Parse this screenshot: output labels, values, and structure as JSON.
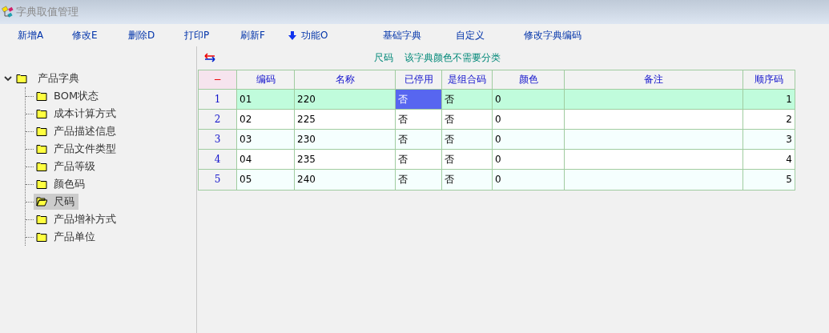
{
  "window": {
    "title": "字典取值管理"
  },
  "toolbar": [
    {
      "label": "新增A",
      "kind": "text"
    },
    {
      "label": "修改E",
      "kind": "text"
    },
    {
      "label": "删除D",
      "kind": "text"
    },
    {
      "label": "打印P",
      "kind": "text"
    },
    {
      "label": "刷新F",
      "kind": "text"
    },
    {
      "label": "功能O",
      "kind": "arrow"
    },
    {
      "label": "基础字典",
      "kind": "text"
    },
    {
      "label": "自定义",
      "kind": "text"
    },
    {
      "label": "修改字典编码",
      "kind": "text"
    }
  ],
  "tree": {
    "label": "产品字典",
    "expanded": true,
    "children": [
      {
        "label": "BOM状态",
        "selected": false
      },
      {
        "label": "成本计算方式",
        "selected": false
      },
      {
        "label": "产品描述信息",
        "selected": false
      },
      {
        "label": "产品文件类型",
        "selected": false
      },
      {
        "label": "产品等级",
        "selected": false
      },
      {
        "label": "颜色码",
        "selected": false
      },
      {
        "label": "尺码",
        "selected": true
      },
      {
        "label": "产品增补方式",
        "selected": false
      },
      {
        "label": "产品单位",
        "selected": false
      }
    ]
  },
  "header": {
    "name": "尺码",
    "note": "该字典颜色不需要分类"
  },
  "table": {
    "corner": "−",
    "columns": [
      "编码",
      "名称",
      "已停用",
      "是组合码",
      "颜色",
      "备注",
      "顺序码"
    ],
    "rows": [
      {
        "number": "1",
        "selected": true,
        "cells": [
          {
            "text": "01",
            "focused": false
          },
          {
            "text": "220",
            "focused": false
          },
          {
            "text": "否",
            "focused": true
          },
          {
            "text": "否",
            "focused": false
          },
          {
            "text": "0",
            "focused": false
          },
          {
            "text": "",
            "focused": false
          },
          {
            "text": "1",
            "focused": false
          }
        ]
      },
      {
        "number": "2",
        "selected": false,
        "cells": [
          {
            "text": "02",
            "focused": false
          },
          {
            "text": "225",
            "focused": false
          },
          {
            "text": "否",
            "focused": false
          },
          {
            "text": "否",
            "focused": false
          },
          {
            "text": "0",
            "focused": false
          },
          {
            "text": "",
            "focused": false
          },
          {
            "text": "2",
            "focused": false
          }
        ]
      },
      {
        "number": "3",
        "selected": false,
        "cells": [
          {
            "text": "03",
            "focused": false
          },
          {
            "text": "230",
            "focused": false
          },
          {
            "text": "否",
            "focused": false
          },
          {
            "text": "否",
            "focused": false
          },
          {
            "text": "0",
            "focused": false
          },
          {
            "text": "",
            "focused": false
          },
          {
            "text": "3",
            "focused": false
          }
        ]
      },
      {
        "number": "4",
        "selected": false,
        "cells": [
          {
            "text": "04",
            "focused": false
          },
          {
            "text": "235",
            "focused": false
          },
          {
            "text": "否",
            "focused": false
          },
          {
            "text": "否",
            "focused": false
          },
          {
            "text": "0",
            "focused": false
          },
          {
            "text": "",
            "focused": false
          },
          {
            "text": "4",
            "focused": false
          }
        ]
      },
      {
        "number": "5",
        "selected": false,
        "cells": [
          {
            "text": "05",
            "focused": false
          },
          {
            "text": "240",
            "focused": false
          },
          {
            "text": "否",
            "focused": false
          },
          {
            "text": "否",
            "focused": false
          },
          {
            "text": "0",
            "focused": false
          },
          {
            "text": "",
            "focused": false
          },
          {
            "text": "5",
            "focused": false
          }
        ]
      }
    ]
  }
}
